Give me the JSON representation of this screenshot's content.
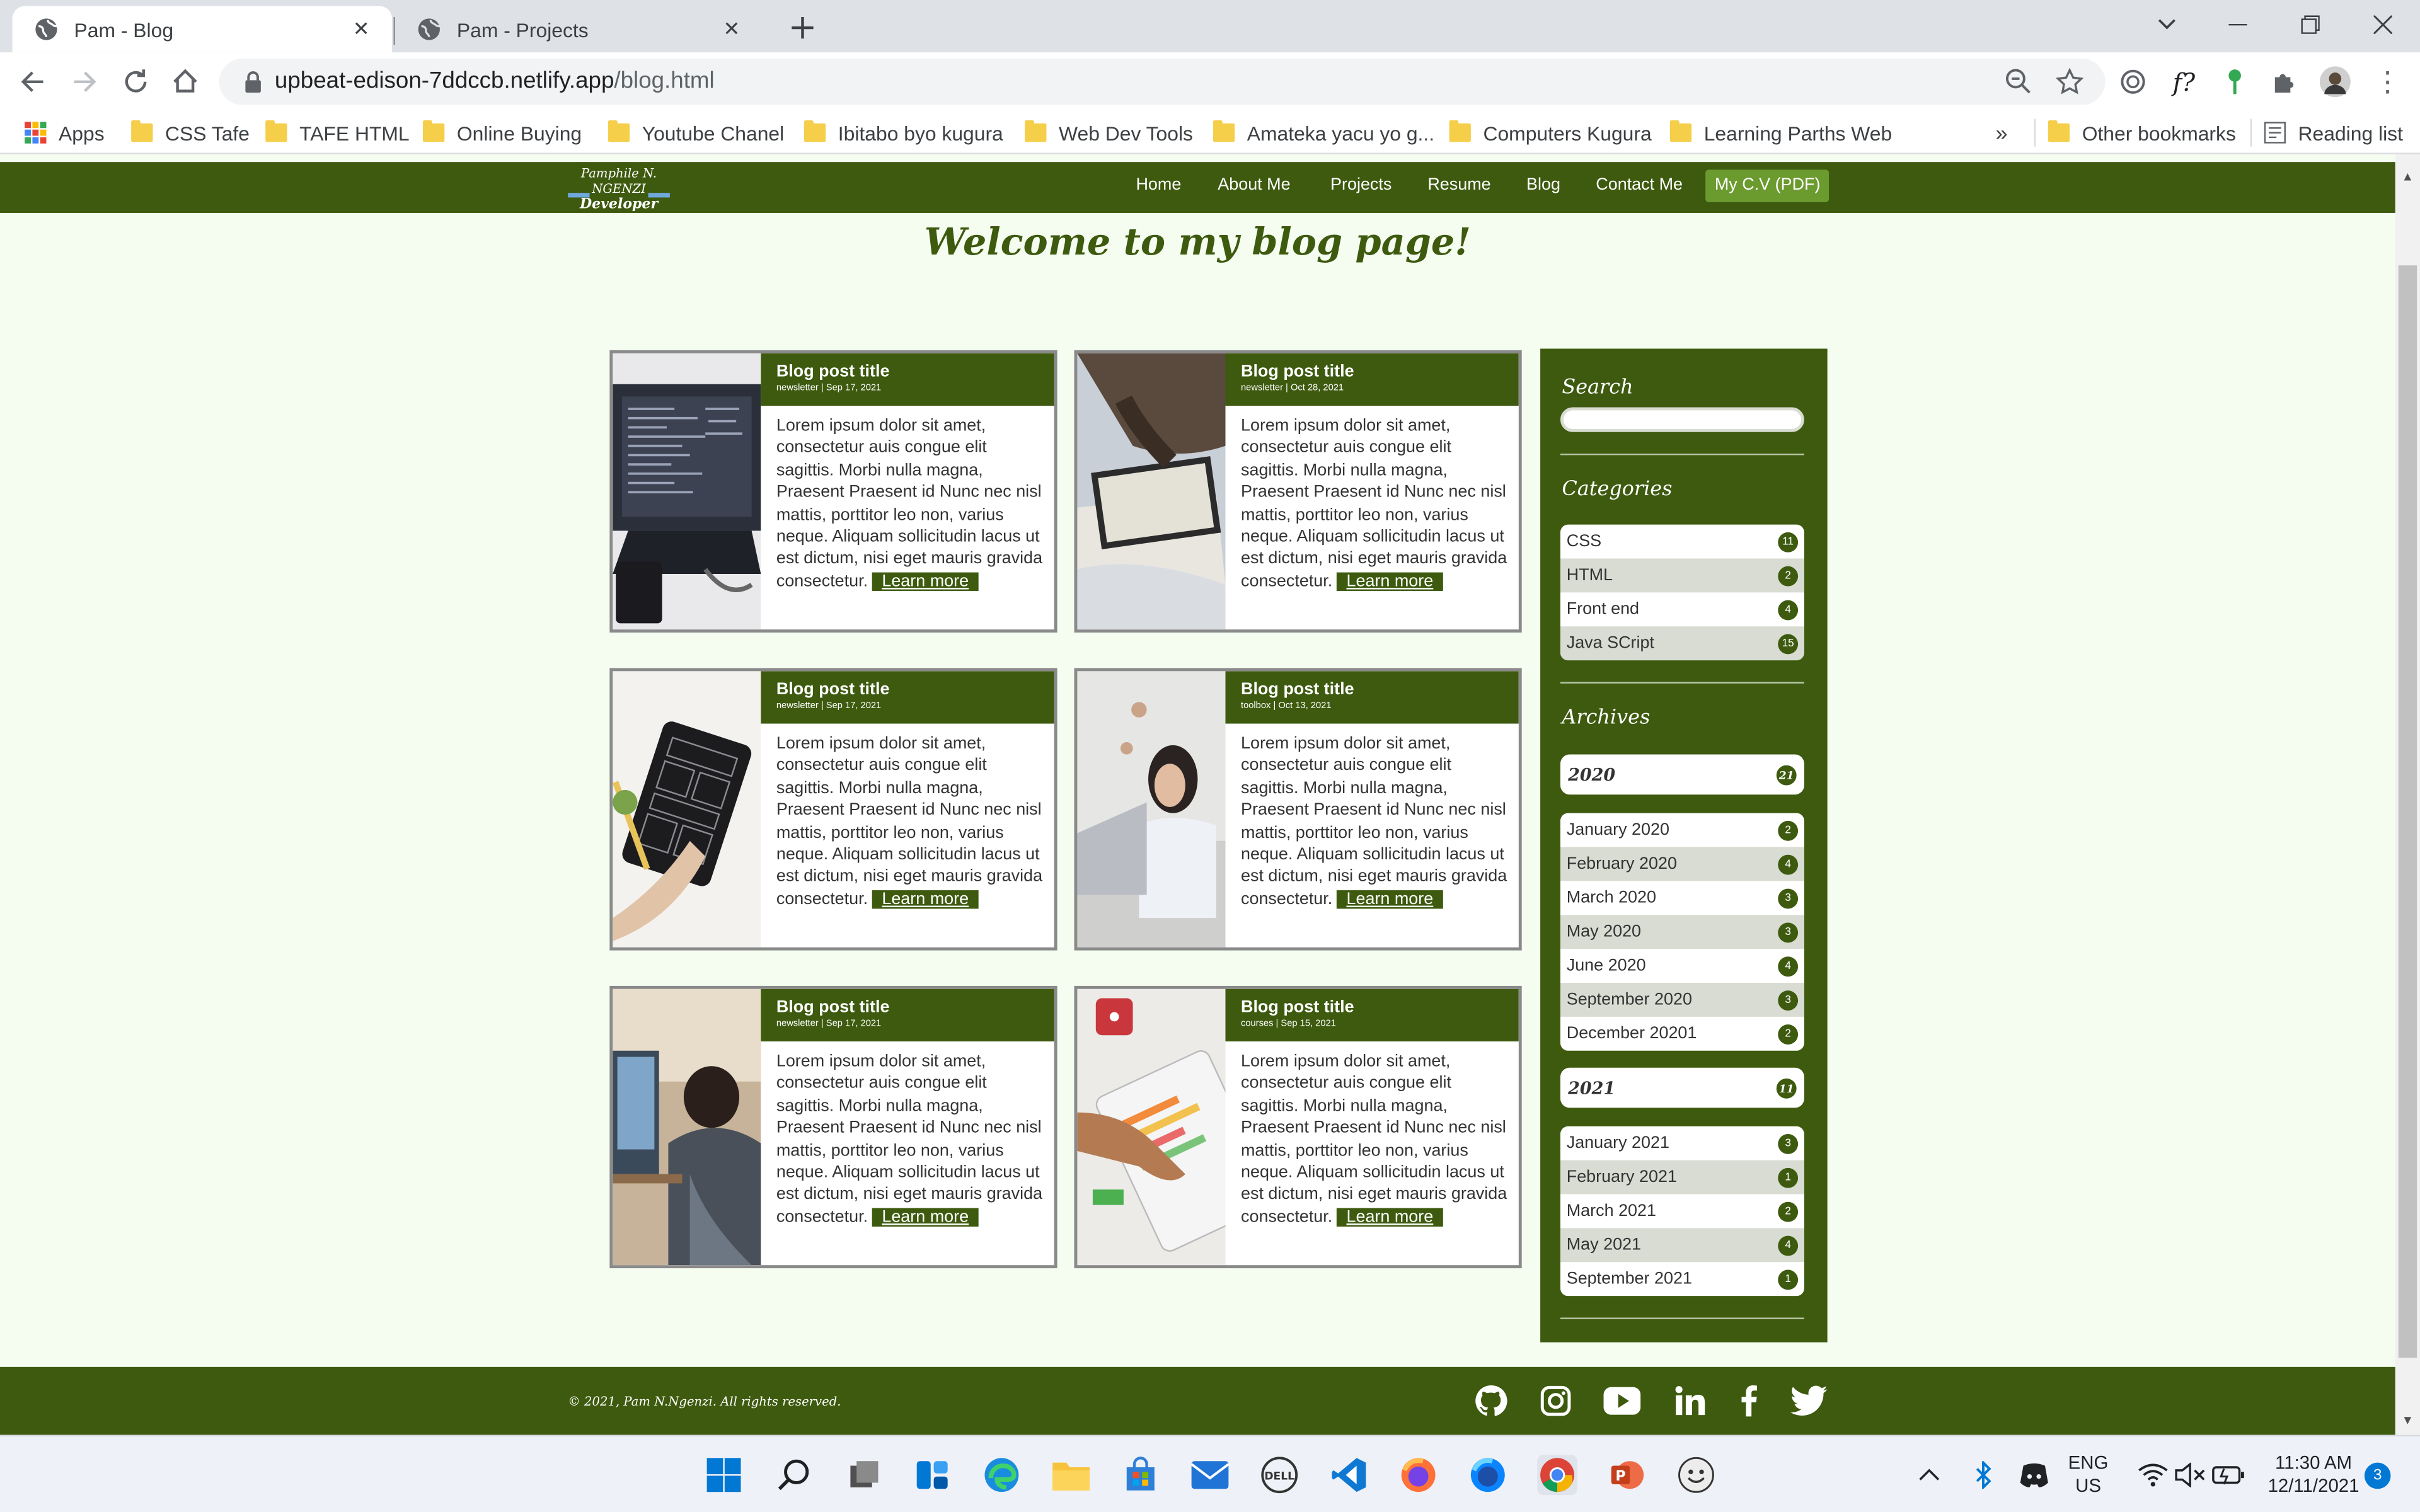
{
  "browser": {
    "tabs": [
      {
        "title": "Pam - Blog",
        "active": true
      },
      {
        "title": "Pam - Projects",
        "active": false
      }
    ],
    "url_host": "upbeat-edison-7ddccb.netlify.app",
    "url_path": "/blog.html",
    "bookmarks": [
      "Apps",
      "CSS Tafe",
      "TAFE HTML",
      "Online  Buying",
      "Youtube Chanel",
      "Ibitabo byo kugura",
      "Web Dev Tools",
      "Amateka yacu yo g...",
      "Computers Kugura",
      "Learning Parths Web"
    ],
    "bookmarks_overflow": "»",
    "other_bookmarks": "Other bookmarks",
    "reading_list": "Reading list"
  },
  "site": {
    "logo_line1": "Pamphile N. NGENZI",
    "logo_line2": "Developer",
    "nav": [
      "Home",
      "About Me",
      "Projects",
      "Resume",
      "Blog",
      "Contact Me"
    ],
    "cv_button": "My C.V (PDF)",
    "page_title": "Welcome to my blog page!"
  },
  "posts": [
    {
      "title": "Blog post title",
      "meta": "newsletter | Sep 17, 2021",
      "body": "Lorem ipsum dolor sit amet, consectetur auis congue elit sagittis. Morbi nulla magna, Praesent Praesent id Nunc nec nisl mattis, porttitor leo non, varius neque. Aliquam sollicitudin lacus ut est dictum, nisi eget mauris gravida consectetur.",
      "more": "Learn more",
      "image": "laptop-code-photo"
    },
    {
      "title": "Blog post title",
      "meta": "newsletter | Oct 28, 2021",
      "body": "Lorem ipsum dolor sit amet, consectetur auis congue elit sagittis. Morbi nulla magna, Praesent Praesent id Nunc nec nisl mattis, porttitor leo non, varius neque. Aliquam sollicitudin lacus ut est dictum, nisi eget mauris gravida consectetur.",
      "more": "Learn more",
      "image": "tablet-hands-photo"
    },
    {
      "title": "Blog post title",
      "meta": "newsletter | Sep 17, 2021",
      "body": "Lorem ipsum dolor sit amet, consectetur auis congue elit sagittis. Morbi nulla magna, Praesent Praesent id Nunc nec nisl mattis, porttitor leo non, varius neque. Aliquam sollicitudin lacus ut est dictum, nisi eget mauris gravida consectetur.",
      "more": "Learn more",
      "image": "tablet-wireframe-photo"
    },
    {
      "title": "Blog post title",
      "meta": "toolbox | Oct 13, 2021",
      "body": "Lorem ipsum dolor sit amet, consectetur auis congue elit sagittis. Morbi nulla magna, Praesent Praesent id Nunc nec nisl mattis, porttitor leo non, varius neque. Aliquam sollicitudin lacus ut est dictum, nisi eget mauris gravida consectetur.",
      "more": "Learn more",
      "image": "woman-laptop-photo"
    },
    {
      "title": "Blog post title",
      "meta": "newsletter | Sep 17, 2021",
      "body": "Lorem ipsum dolor sit amet, consectetur auis congue elit sagittis. Morbi nulla magna, Praesent Praesent id Nunc nec nisl mattis, porttitor leo non, varius neque. Aliquam sollicitudin lacus ut est dictum, nisi eget mauris gravida consectetur.",
      "more": "Learn more",
      "image": "boy-computer-photo"
    },
    {
      "title": "Blog post title",
      "meta": "courses | Sep 15, 2021",
      "body": "Lorem ipsum dolor sit amet, consectetur auis congue elit sagittis. Morbi nulla magna, Praesent Praesent id Nunc nec nisl mattis, porttitor leo non, varius neque. Aliquam sollicitudin lacus ut est dictum, nisi eget mauris gravida consectetur.",
      "more": "Learn more",
      "image": "child-tablet-photo"
    }
  ],
  "sidebar": {
    "search_heading": "Search",
    "categories_heading": "Categories",
    "categories": [
      {
        "name": "CSS",
        "count": "11"
      },
      {
        "name": "HTML",
        "count": "2"
      },
      {
        "name": "Front end",
        "count": "4"
      },
      {
        "name": "Java SCript",
        "count": "15"
      }
    ],
    "archives_heading": "Archives",
    "years": [
      {
        "year": "2020",
        "count": "21",
        "months": [
          {
            "name": "January 2020",
            "count": "2"
          },
          {
            "name": "February 2020",
            "count": "4"
          },
          {
            "name": "March 2020",
            "count": "3"
          },
          {
            "name": "May 2020",
            "count": "3"
          },
          {
            "name": "June 2020",
            "count": "4"
          },
          {
            "name": "September 2020",
            "count": "3"
          },
          {
            "name": "December 20201",
            "count": "2"
          }
        ]
      },
      {
        "year": "2021",
        "count": "11",
        "months": [
          {
            "name": "January 2021",
            "count": "3"
          },
          {
            "name": "February 2021",
            "count": "1"
          },
          {
            "name": "March 2021",
            "count": "2"
          },
          {
            "name": "May 2021",
            "count": "4"
          },
          {
            "name": "September 2021",
            "count": "1"
          }
        ]
      }
    ]
  },
  "footer": {
    "copyright": "© 2021, Pam N.Ngenzi. All rights reserved.",
    "social": [
      "github-icon",
      "instagram-icon",
      "youtube-icon",
      "linkedin-icon",
      "facebook-icon",
      "twitter-icon"
    ]
  },
  "taskbar": {
    "apps": [
      "windows-start-icon",
      "search-icon",
      "task-view-icon",
      "widgets-icon",
      "edge-icon",
      "file-explorer-icon",
      "store-icon",
      "mail-icon",
      "dell-icon",
      "vscode-icon",
      "firefox-icon",
      "firefox-dev-icon",
      "chrome-icon",
      "powerpoint-icon",
      "emoji-app-icon"
    ],
    "lang_line1": "ENG",
    "lang_line2": "US",
    "time": "11:30 AM",
    "date": "12/11/2021",
    "notification_count": "3"
  },
  "colors": {
    "brand_green": "#3d5a0f",
    "accent_green": "#6b9a2e",
    "page_bg": "#f5fcf0"
  }
}
